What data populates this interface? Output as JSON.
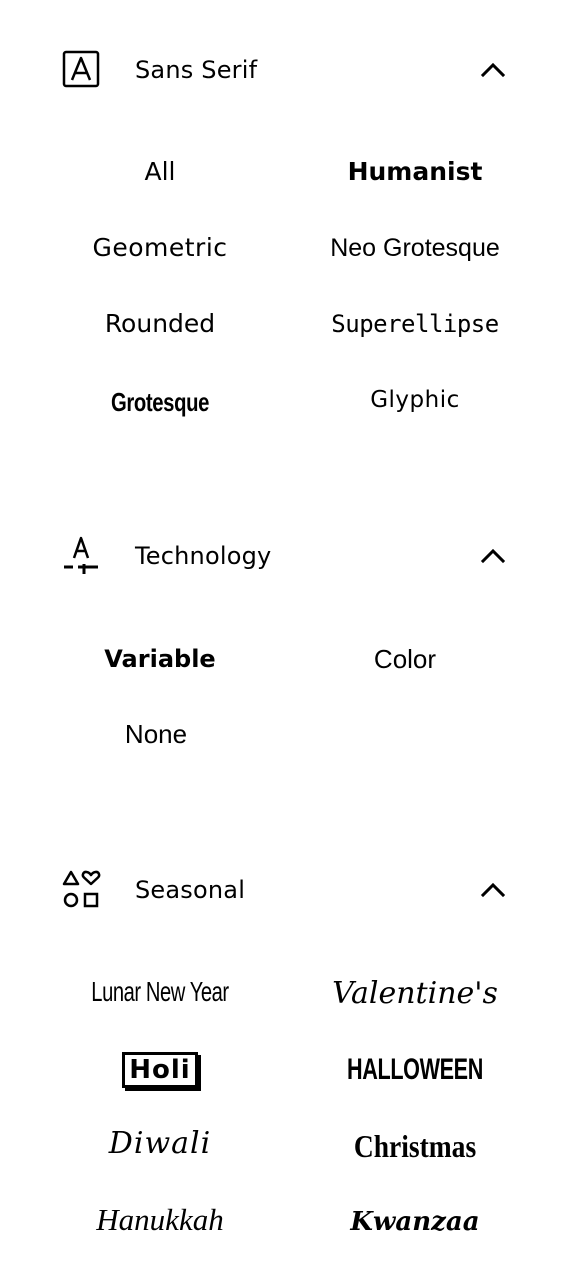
{
  "sections": [
    {
      "title": "Sans Serif",
      "icon": "font-letter-a-icon",
      "chevron_icon": "chevron-up-icon",
      "items": [
        "All",
        "Humanist",
        "Geometric",
        "Neo Grotesque",
        "Rounded",
        "Superellipse",
        "Grotesque",
        "Glyphic"
      ]
    },
    {
      "title": "Technology",
      "icon": "font-technology-icon",
      "chevron_icon": "chevron-up-icon",
      "items": [
        "Variable",
        "Color",
        "None"
      ]
    },
    {
      "title": "Seasonal",
      "icon": "shapes-icon",
      "chevron_icon": "chevron-up-icon",
      "items": [
        "Lunar New Year",
        "Valentine's",
        "Holi",
        "HALLOWEEN",
        "Diwali",
        "Christmas",
        "Hanukkah",
        "Kwanzaa"
      ]
    }
  ]
}
